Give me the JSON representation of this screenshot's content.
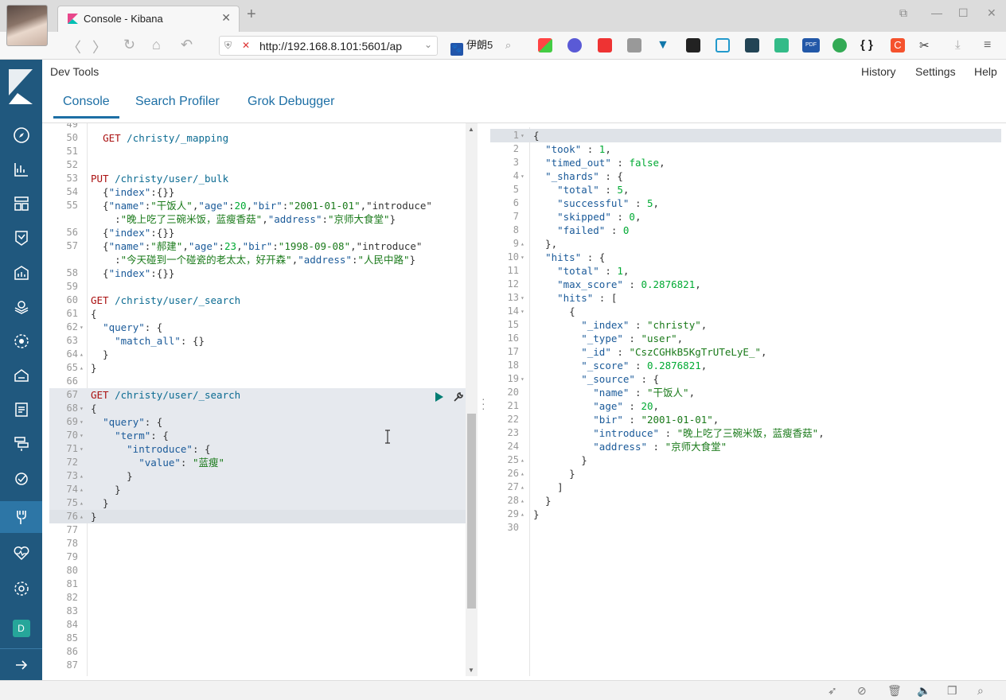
{
  "browser": {
    "tab_title": "Console - Kibana",
    "tab_close": "✕",
    "new_tab": "+",
    "url": "http://192.168.8.101:5601/ap",
    "search_engine_label": "伊朗5",
    "window_controls": [
      "⧉",
      "—",
      "☐",
      "✕"
    ],
    "nav_glyphs": {
      "back": "〈",
      "forward": "〉",
      "reload": "↻",
      "home": "⌂",
      "undo": "↶"
    },
    "ext_braces": "{ }",
    "ext_c": "C",
    "ext_pdf": "PDF"
  },
  "kibana": {
    "header_title": "Dev Tools",
    "menu": {
      "history": "History",
      "settings": "Settings",
      "help": "Help"
    },
    "tabs": {
      "console": "Console",
      "search_profiler": "Search Profiler",
      "grok_debugger": "Grok Debugger"
    },
    "avatar_initial": "D",
    "nav_icons": [
      "compass-icon",
      "chart-icon",
      "dashboard-icon",
      "timelion-icon",
      "canvas-icon",
      "maps-icon",
      "ml-icon",
      "infrastructure-icon",
      "logs-icon",
      "apm-icon",
      "uptime-icon",
      "devtools-icon",
      "monitoring-icon",
      "management-icon"
    ]
  },
  "left_editor": {
    "lines": [
      {
        "n": "49",
        "t": "",
        "top": true
      },
      {
        "n": "50",
        "t": "  GET /christy/_mapping"
      },
      {
        "n": "51",
        "t": ""
      },
      {
        "n": "52",
        "t": ""
      },
      {
        "n": "53",
        "t": "PUT /christy/user/_bulk"
      },
      {
        "n": "54",
        "t": "  {\"index\":{}}"
      },
      {
        "n": "55",
        "t": "  {\"name\":\"干饭人\",\"age\":20,\"bir\":\"2001-01-01\",\"introduce\""
      },
      {
        "n": "",
        "t": "    :\"晚上吃了三碗米饭，蓝瘦香菇\",\"address\":\"京师大食堂\"}"
      },
      {
        "n": "56",
        "t": "  {\"index\":{}}"
      },
      {
        "n": "57",
        "t": "  {\"name\":\"郝建\",\"age\":23,\"bir\":\"1998-09-08\",\"introduce\""
      },
      {
        "n": "",
        "t": "    :\"今天碰到一个碰瓷的老太太，好开森\",\"address\":\"人民中路\"}"
      },
      {
        "n": "58",
        "t": "  {\"index\":{}}"
      },
      {
        "n": "59",
        "t": ""
      },
      {
        "n": "60",
        "t": "GET /christy/user/_search"
      },
      {
        "n": "61",
        "t": "{",
        "f": "fold"
      },
      {
        "n": "62",
        "t": "  \"query\": {",
        "f": "▾"
      },
      {
        "n": "63",
        "t": "    \"match_all\": {}"
      },
      {
        "n": "64",
        "t": "  }",
        "f": "▴"
      },
      {
        "n": "65",
        "t": "}",
        "f": "▴"
      },
      {
        "n": "66",
        "t": ""
      },
      {
        "n": "67",
        "t": "GET /christy/user/_search",
        "h": 1
      },
      {
        "n": "68",
        "t": "{",
        "f": "▾",
        "h": 1
      },
      {
        "n": "69",
        "t": "  \"query\": {",
        "f": "▾",
        "h": 1
      },
      {
        "n": "70",
        "t": "    \"term\": {",
        "f": "▾",
        "h": 1
      },
      {
        "n": "71",
        "t": "      \"introduce\": {",
        "f": "▾",
        "h": 1
      },
      {
        "n": "72",
        "t": "        \"value\": \"蓝瘦\"",
        "h": 1
      },
      {
        "n": "73",
        "t": "      }",
        "f": "▴",
        "h": 1
      },
      {
        "n": "74",
        "t": "    }",
        "f": "▴",
        "h": 1
      },
      {
        "n": "75",
        "t": "  }",
        "f": "▴",
        "h": 1
      },
      {
        "n": "76",
        "t": "}",
        "f": "▴",
        "h": 2
      },
      {
        "n": "77",
        "t": ""
      },
      {
        "n": "78",
        "t": ""
      },
      {
        "n": "79",
        "t": ""
      },
      {
        "n": "80",
        "t": ""
      },
      {
        "n": "81",
        "t": ""
      },
      {
        "n": "82",
        "t": ""
      },
      {
        "n": "83",
        "t": ""
      },
      {
        "n": "84",
        "t": ""
      },
      {
        "n": "85",
        "t": ""
      },
      {
        "n": "86",
        "t": ""
      },
      {
        "n": "87",
        "t": ""
      }
    ]
  },
  "right_editor": {
    "lines": [
      {
        "n": "1",
        "t": "{",
        "f": "▾",
        "h": 2
      },
      {
        "n": "2",
        "t": "  \"took\" : 1,"
      },
      {
        "n": "3",
        "t": "  \"timed_out\" : false,"
      },
      {
        "n": "4",
        "t": "  \"_shards\" : {",
        "f": "▾"
      },
      {
        "n": "5",
        "t": "    \"total\" : 5,"
      },
      {
        "n": "6",
        "t": "    \"successful\" : 5,"
      },
      {
        "n": "7",
        "t": "    \"skipped\" : 0,"
      },
      {
        "n": "8",
        "t": "    \"failed\" : 0"
      },
      {
        "n": "9",
        "t": "  },",
        "f": "▴"
      },
      {
        "n": "10",
        "t": "  \"hits\" : {",
        "f": "▾"
      },
      {
        "n": "11",
        "t": "    \"total\" : 1,"
      },
      {
        "n": "12",
        "t": "    \"max_score\" : 0.2876821,"
      },
      {
        "n": "13",
        "t": "    \"hits\" : [",
        "f": "▾"
      },
      {
        "n": "14",
        "t": "      {",
        "f": "▾"
      },
      {
        "n": "15",
        "t": "        \"_index\" : \"christy\","
      },
      {
        "n": "16",
        "t": "        \"_type\" : \"user\","
      },
      {
        "n": "17",
        "t": "        \"_id\" : \"CszCGHkB5KgTrUTeLyE_\","
      },
      {
        "n": "18",
        "t": "        \"_score\" : 0.2876821,"
      },
      {
        "n": "19",
        "t": "        \"_source\" : {",
        "f": "▾"
      },
      {
        "n": "20",
        "t": "          \"name\" : \"干饭人\","
      },
      {
        "n": "21",
        "t": "          \"age\" : 20,"
      },
      {
        "n": "22",
        "t": "          \"bir\" : \"2001-01-01\","
      },
      {
        "n": "23",
        "t": "          \"introduce\" : \"晚上吃了三碗米饭，蓝瘦香菇\","
      },
      {
        "n": "24",
        "t": "          \"address\" : \"京师大食堂\""
      },
      {
        "n": "25",
        "t": "        }",
        "f": "▴"
      },
      {
        "n": "26",
        "t": "      }",
        "f": "▴"
      },
      {
        "n": "27",
        "t": "    ]",
        "f": "▴"
      },
      {
        "n": "28",
        "t": "  }",
        "f": "▴"
      },
      {
        "n": "29",
        "t": "}",
        "f": "▴"
      },
      {
        "n": "30",
        "t": ""
      }
    ]
  },
  "statusbar_icons": [
    "rocket-icon",
    "no-mic-icon",
    "trash-icon",
    "speaker-icon",
    "window-icon",
    "search-icon"
  ]
}
